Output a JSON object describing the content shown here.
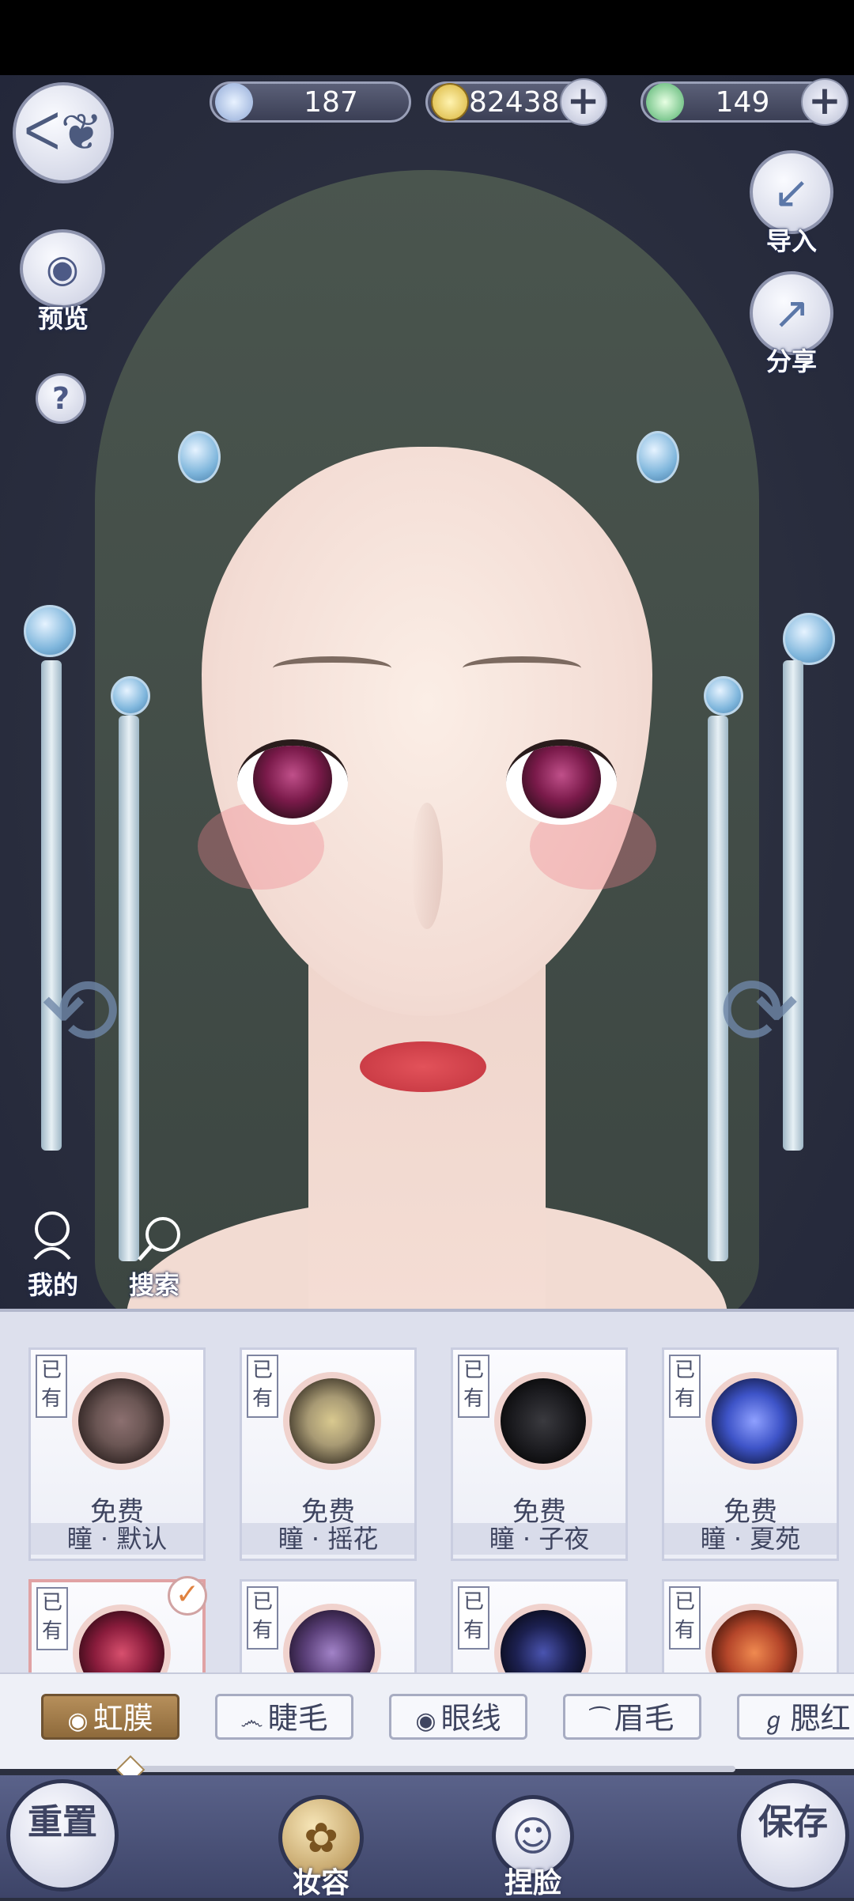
{
  "currency": [
    {
      "icon": "jade-feather-icon",
      "value": "187",
      "plus": false
    },
    {
      "icon": "copper-coin-icon",
      "value": "82438",
      "plus": true
    },
    {
      "icon": "green-spiral-icon",
      "value": "149",
      "plus": true
    }
  ],
  "side_left": {
    "preview_label": "预览",
    "help_symbol": "?",
    "mine_label": "我的",
    "search_label": "搜索"
  },
  "side_right": {
    "import_label": "导入",
    "share_label": "分享"
  },
  "items": [
    {
      "owned": "已有",
      "price": "免费",
      "name": "瞳 · 默认",
      "color": "#6b5654"
    },
    {
      "owned": "已有",
      "price": "免费",
      "name": "瞳 · 摇花",
      "color": "#a89a74"
    },
    {
      "owned": "已有",
      "price": "免费",
      "name": "瞳 · 子夜",
      "color": "#1b1b1f"
    },
    {
      "owned": "已有",
      "price": "免费",
      "name": "瞳 · 夏苑",
      "color": "#3e54c8"
    },
    {
      "owned": "已有",
      "price": "",
      "name": "",
      "color": "#8a1c3c",
      "selected": true
    },
    {
      "owned": "已有",
      "price": "",
      "name": "",
      "color": "#5a3f78"
    },
    {
      "owned": "已有",
      "price": "",
      "name": "",
      "color": "#1c2050"
    },
    {
      "owned": "已有",
      "price": "",
      "name": "",
      "color": "#b5462a"
    }
  ],
  "tabs": [
    {
      "label": "虹膜",
      "icon": "◉",
      "active": true
    },
    {
      "label": "睫毛",
      "icon": "෴"
    },
    {
      "label": "眼线",
      "icon": "◉"
    },
    {
      "label": "眉毛",
      "icon": "⁀"
    },
    {
      "label": "腮红",
      "icon": "ℊ"
    }
  ],
  "nav": {
    "reset_label": "重置",
    "makeup_label": "妆容",
    "face_label": "捏脸",
    "save_label": "保存"
  }
}
